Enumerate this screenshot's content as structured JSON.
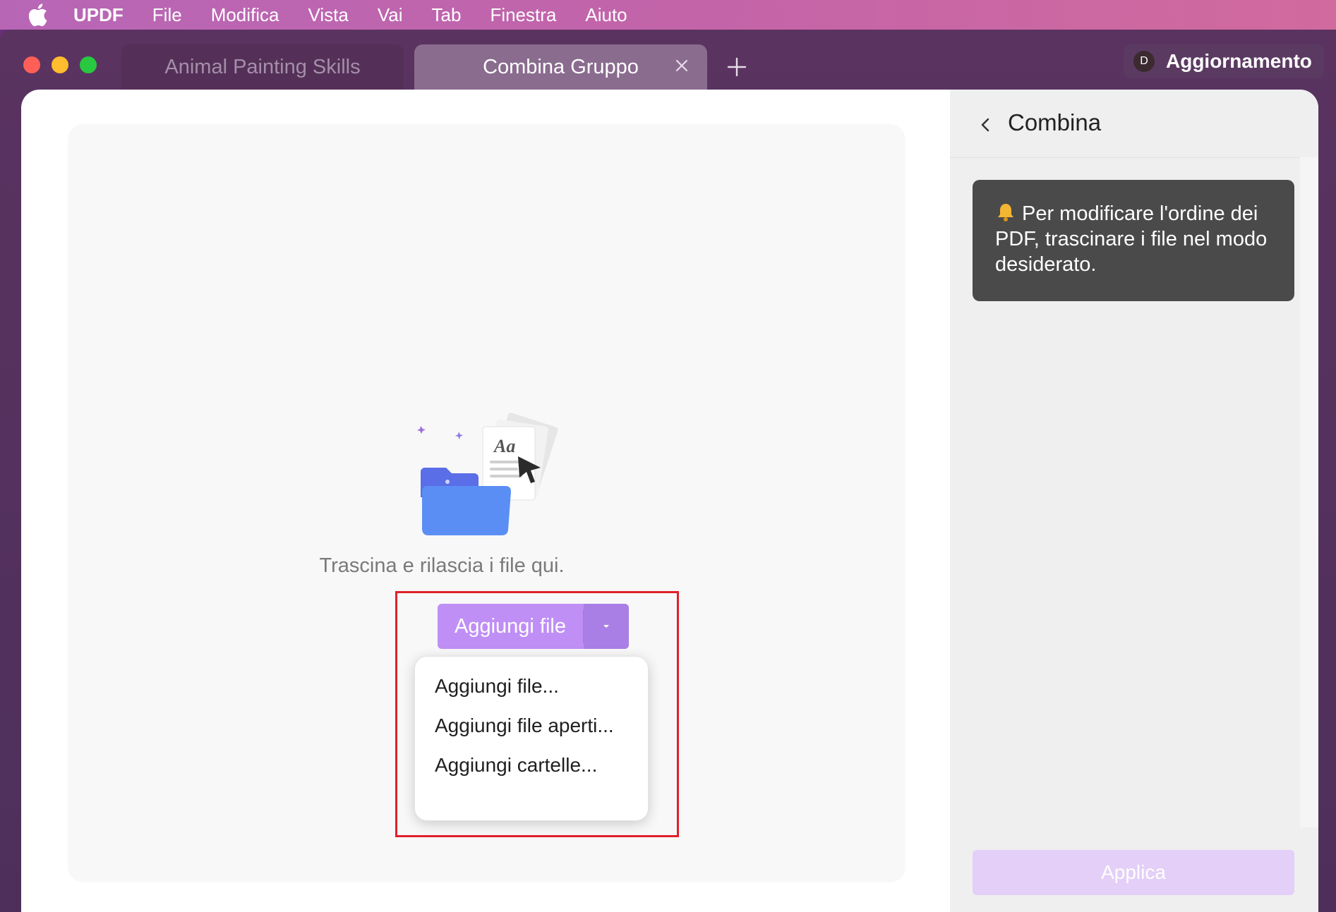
{
  "menubar": {
    "app_name": "UPDF",
    "items": [
      "File",
      "Modifica",
      "Vista",
      "Vai",
      "Tab",
      "Finestra",
      "Aiuto"
    ]
  },
  "tabs": [
    {
      "label": "Animal Painting Skills",
      "active": false
    },
    {
      "label": "Combina Gruppo",
      "active": true
    }
  ],
  "account": {
    "avatar_letter": "D",
    "upgrade_label": "Aggiornamento"
  },
  "dropzone": {
    "hint": "Trascina e rilascia i file qui.",
    "add_button_label": "Aggiungi file",
    "menu_items": [
      "Aggiungi file...",
      "Aggiungi file aperti...",
      "Aggiungi cartelle..."
    ]
  },
  "panel": {
    "title": "Combina",
    "tip": "Per modificare l'ordine dei PDF, trascinare i file nel modo desiderato.",
    "apply_label": "Applica"
  },
  "colors": {
    "accent": "#bf8ff5",
    "highlight_border": "#e0202a",
    "tip_background": "#4a4a4a",
    "apply_disabled": "#e3cff7"
  }
}
